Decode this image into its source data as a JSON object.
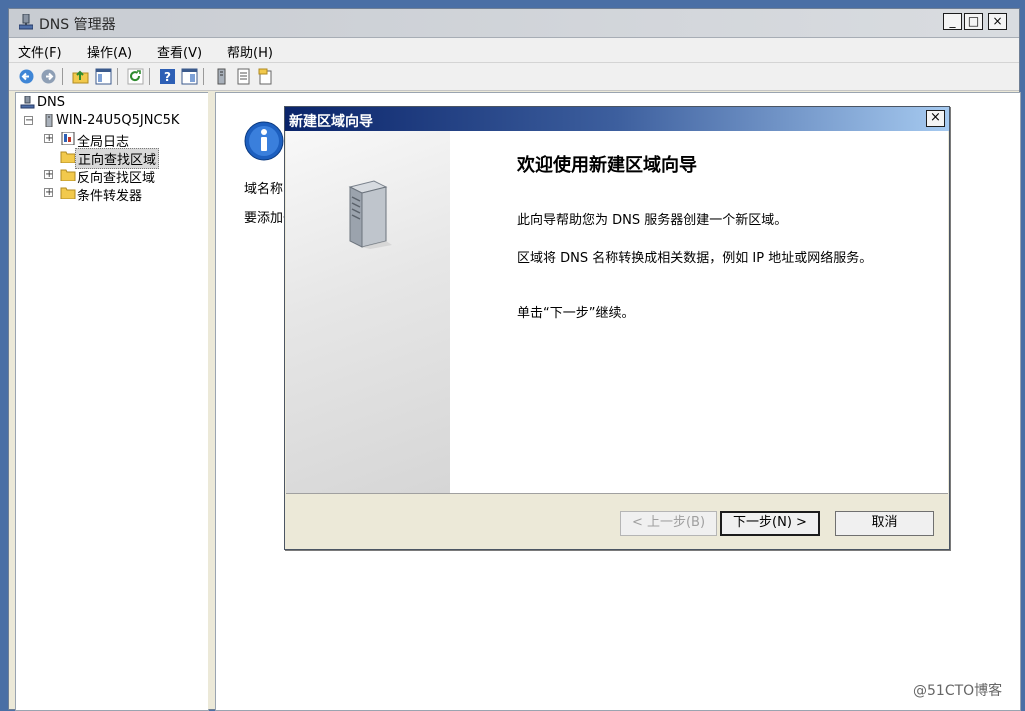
{
  "window": {
    "title": "DNS 管理器",
    "min_glyph": "_",
    "max_glyph": "□",
    "close_glyph": "×"
  },
  "menu": [
    "文件(F)",
    "操作(A)",
    "查看(V)",
    "帮助(H)"
  ],
  "toolbar": {
    "icons": [
      "back-icon",
      "forward-icon",
      "up-folder-icon",
      "show-tree-icon",
      "refresh-icon",
      "help-icon",
      "properties-icon",
      "server-list-icon",
      "list-view-icon",
      "export-icon"
    ]
  },
  "tree": {
    "root": "DNS",
    "server": "WIN-24U5Q5JNC5K",
    "children": [
      "全局日志",
      "正向查找区域",
      "反向查找区域",
      "条件转发器"
    ],
    "selected": "正向查找区域",
    "expand_glyph": "+",
    "collapse_glyph": "−"
  },
  "content": {
    "line1": "域名称系",
    "line2": "要添加一"
  },
  "dialog": {
    "title": "新建区域向导",
    "close_glyph": "×",
    "heading": "欢迎使用新建区域向导",
    "p1": "此向导帮助您为 DNS 服务器创建一个新区域。",
    "p2": "区域将 DNS 名称转换成相关数据，例如 IP 地址或网络服务。",
    "p3": "单击“下一步”继续。",
    "back_label": "< 上一步(B)",
    "next_label": "下一步(N) >",
    "cancel_label": "取消"
  },
  "watermark": "@51CTO博客"
}
